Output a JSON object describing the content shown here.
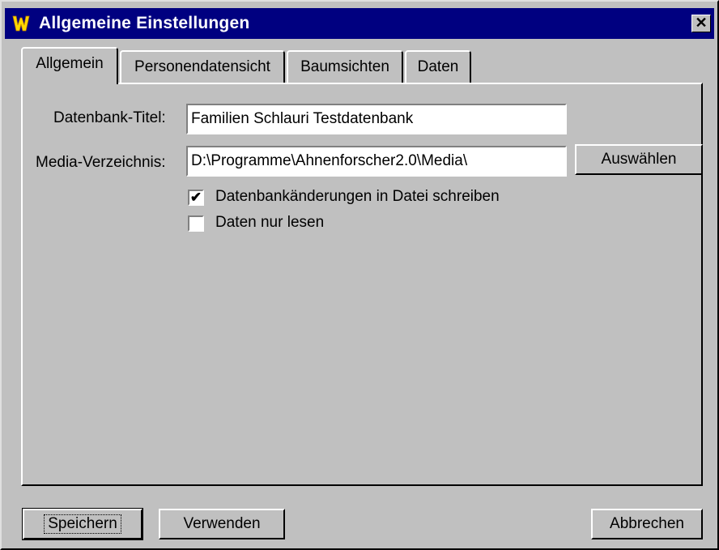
{
  "window": {
    "title": "Allgemeine Einstellungen",
    "close_glyph": "✕",
    "app_icon": "w-logo-icon"
  },
  "tabs": [
    {
      "label": "Allgemein",
      "active": true
    },
    {
      "label": "Personendatensicht",
      "active": false
    },
    {
      "label": "Baumsichten",
      "active": false
    },
    {
      "label": "Daten",
      "active": false
    }
  ],
  "form": {
    "db_title_label": "Datenbank-Titel:",
    "db_title_value": "Familien Schlauri Testdatenbank",
    "media_label": "Media-Verzeichnis:",
    "media_value": "D:\\Programme\\Ahnenforscher2.0\\Media\\",
    "select_button": "Auswählen",
    "write_changes": {
      "label": "Datenbankänderungen in Datei schreiben",
      "checked": true,
      "mark": "✔"
    },
    "read_only": {
      "label": "Daten nur lesen",
      "checked": false,
      "mark": ""
    }
  },
  "footer": {
    "save_label": "Speichern",
    "apply_label": "Verwenden",
    "cancel_label": "Abbrechen"
  },
  "colors": {
    "titlebar": "#000080",
    "face": "#c0c0c0",
    "icon_yellow": "#ffd800"
  }
}
